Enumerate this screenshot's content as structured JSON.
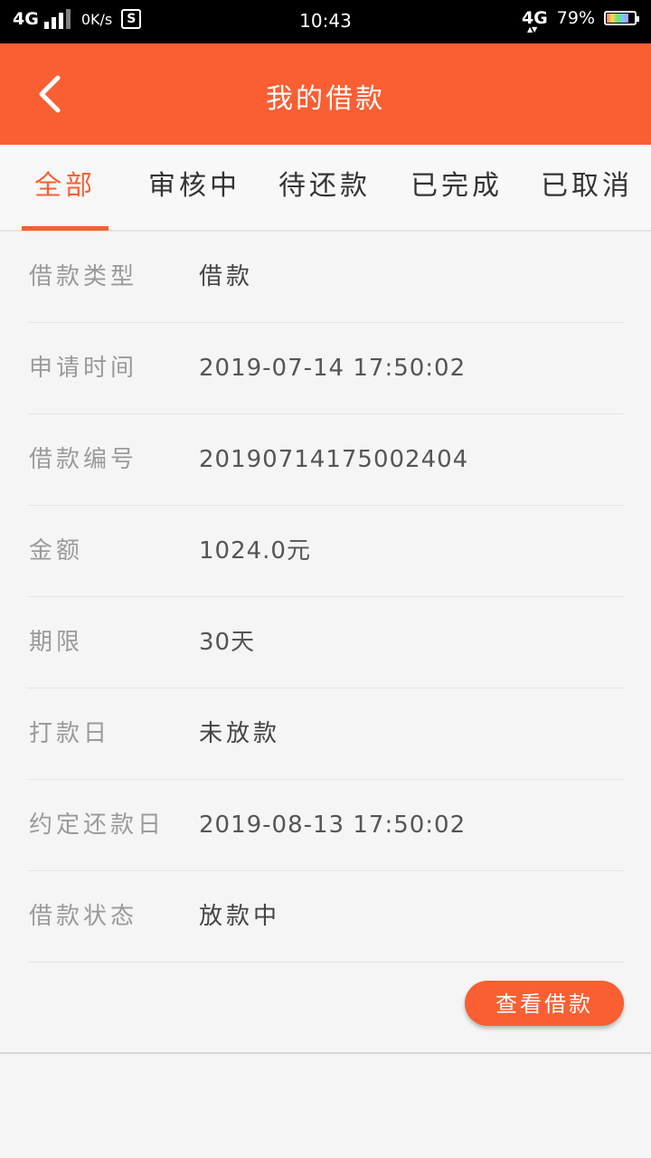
{
  "statusbar": {
    "network_left": "4G",
    "speed": "0K/s",
    "s_icon_label": "S",
    "time": "10:43",
    "network_right": "4G",
    "battery": "79%",
    "battery_level": 0.79
  },
  "header": {
    "title": "我的借款",
    "back_icon": "chevron-left-icon"
  },
  "tabs": [
    {
      "label": "全部",
      "active": true
    },
    {
      "label": "审核中",
      "active": false
    },
    {
      "label": "待还款",
      "active": false
    },
    {
      "label": "已完成",
      "active": false
    },
    {
      "label": "已取消",
      "active": false
    }
  ],
  "details": {
    "rows": [
      {
        "label": "借款类型",
        "value": "借款"
      },
      {
        "label": "申请时间",
        "value": "2019-07-14 17:50:02"
      },
      {
        "label": "借款编号",
        "value": "20190714175002404"
      },
      {
        "label": "金额",
        "value": "1024.0元"
      },
      {
        "label": "期限",
        "value": "30天"
      },
      {
        "label": "打款日",
        "value": "未放款"
      },
      {
        "label": "约定还款日",
        "value": "2019-08-13 17:50:02"
      },
      {
        "label": "借款状态",
        "value": "放款中"
      }
    ]
  },
  "actions": {
    "view_loan_label": "查看借款"
  },
  "colors": {
    "accent": "#f95f33"
  }
}
